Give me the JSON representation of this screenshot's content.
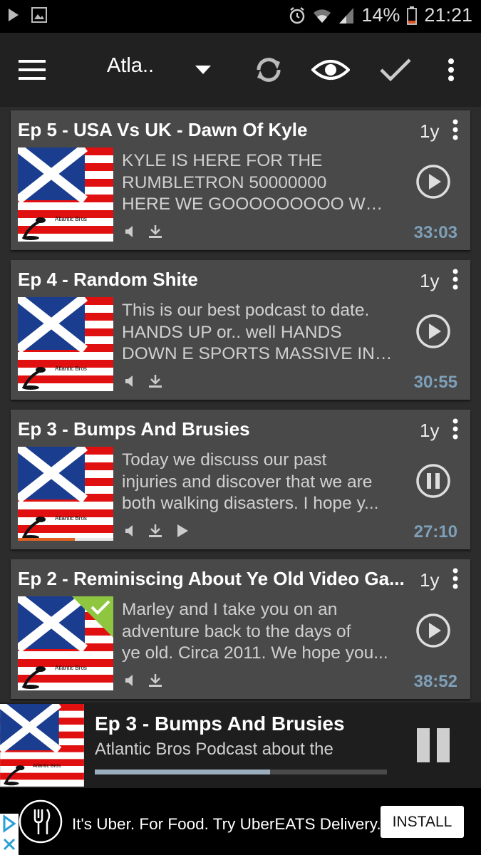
{
  "status_bar": {
    "battery": "14%",
    "time": "21:21"
  },
  "toolbar": {
    "feed_title": "Atla.."
  },
  "episodes": [
    {
      "title": "Ep 5 - USA Vs UK - Dawn Of Kyle",
      "age": "1y",
      "desc": [
        "KYLE IS HERE FOR THE",
        "RUMBLETRON 50000000",
        "HERE WE GOOOOOOOOO WOO..."
      ],
      "duration": "33:03",
      "state": "play"
    },
    {
      "title": "Ep 4 - Random Shite",
      "age": "1y",
      "desc": [
        "This is our best podcast to date.",
        "HANDS UP or.. well HANDS",
        "DOWN E SPORTS MASSIVE INT..."
      ],
      "duration": "30:55",
      "state": "play"
    },
    {
      "title": "Ep 3 - Bumps And Brusies",
      "age": "1y",
      "desc": [
        "Today we discuss our past",
        "injuries and discover that we are",
        "both walking disasters. I hope y..."
      ],
      "duration": "27:10",
      "state": "pause",
      "progress": 0.6
    },
    {
      "title": "Ep 2 -  Reminiscing About Ye Old Video Ga...",
      "age": "1y",
      "desc": [
        "Marley and I take you on an",
        "adventure back to the days of",
        "ye old. Circa 2011. We hope you..."
      ],
      "duration": "38:52",
      "state": "play",
      "new": true
    }
  ],
  "thumb_caption": "Atlantic Bros",
  "player": {
    "title": "Ep 3 - Bumps And Brusies",
    "subtitle": "Atlantic Bros Podcast about the",
    "progress": 0.6
  },
  "ad": {
    "text": "It's Uber. For Food. Try UberEATS Delivery.",
    "button": "INSTALL"
  },
  "colors": {
    "duration": "#7e9fb8",
    "new_badge": "#8ec63f",
    "card": "#494949"
  }
}
